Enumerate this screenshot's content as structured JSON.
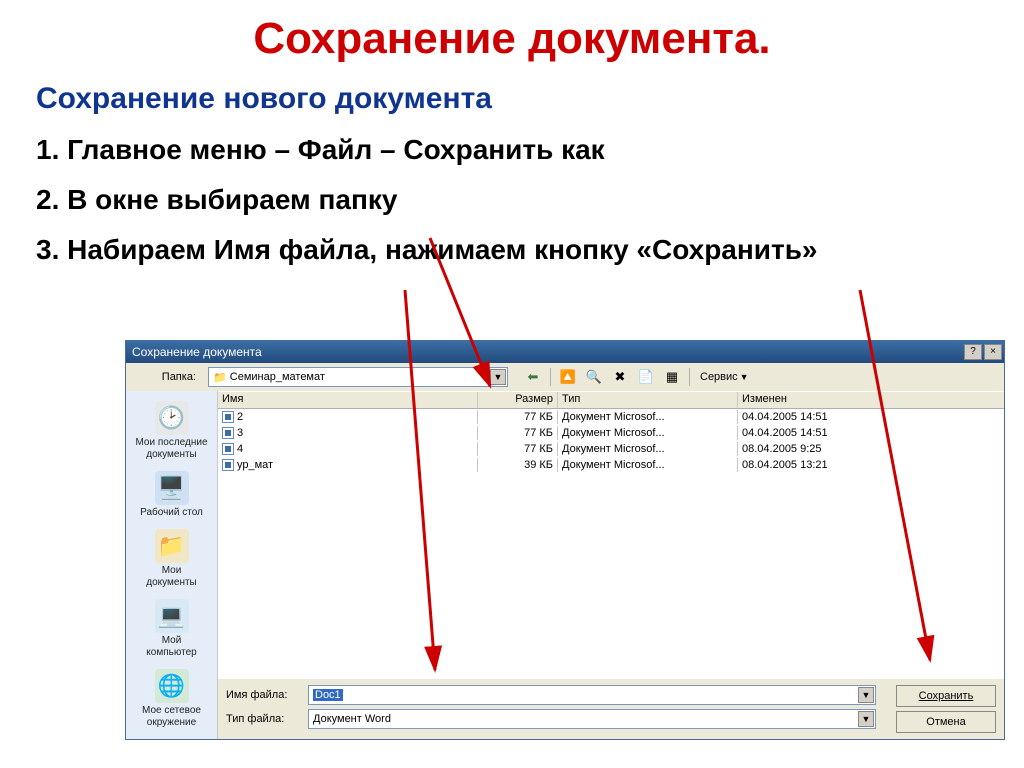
{
  "title": "Сохранение документа.",
  "subtitle": "Сохранение нового документа",
  "steps": [
    "1. Главное меню – Файл – Сохранить как",
    "2. В окне выбираем папку",
    "3. Набираем Имя файла, нажимаем кнопку «Сохранить»"
  ],
  "dialog": {
    "title": "Сохранение документа",
    "help": "?",
    "close": "×",
    "folder_label": "Папка:",
    "folder_value": "Семинар_математ",
    "service_label": "Сервис",
    "places": [
      {
        "label": "Мои последние\nдокументы",
        "icon": "🕑"
      },
      {
        "label": "Рабочий стол",
        "icon": "🖥️"
      },
      {
        "label": "Мои\nдокументы",
        "icon": "📁"
      },
      {
        "label": "Мой\nкомпьютер",
        "icon": "💻"
      },
      {
        "label": "Мое сетевое\nокружение",
        "icon": "🌐"
      }
    ],
    "columns": {
      "name": "Имя",
      "size": "Размер",
      "type": "Тип",
      "modified": "Изменен"
    },
    "files": [
      {
        "name": "2",
        "size": "77 КБ",
        "type": "Документ Microsof...",
        "modified": "04.04.2005 14:51"
      },
      {
        "name": "3",
        "size": "77 КБ",
        "type": "Документ Microsof...",
        "modified": "04.04.2005 14:51"
      },
      {
        "name": "4",
        "size": "77 КБ",
        "type": "Документ Microsof...",
        "modified": "08.04.2005 9:25"
      },
      {
        "name": "ур_мат",
        "size": "39 КБ",
        "type": "Документ Microsof...",
        "modified": "08.04.2005 13:21"
      }
    ],
    "filename_label": "Имя файла:",
    "filename_value": "Doc1",
    "filetype_label": "Тип файла:",
    "filetype_value": "Документ Word",
    "save_btn": "Сохранить",
    "cancel_btn": "Отмена",
    "toolbar_icons": {
      "back": "⬅",
      "up": "🔼",
      "search": "🔍",
      "delete": "✖",
      "new": "📄",
      "views": "▦"
    }
  }
}
